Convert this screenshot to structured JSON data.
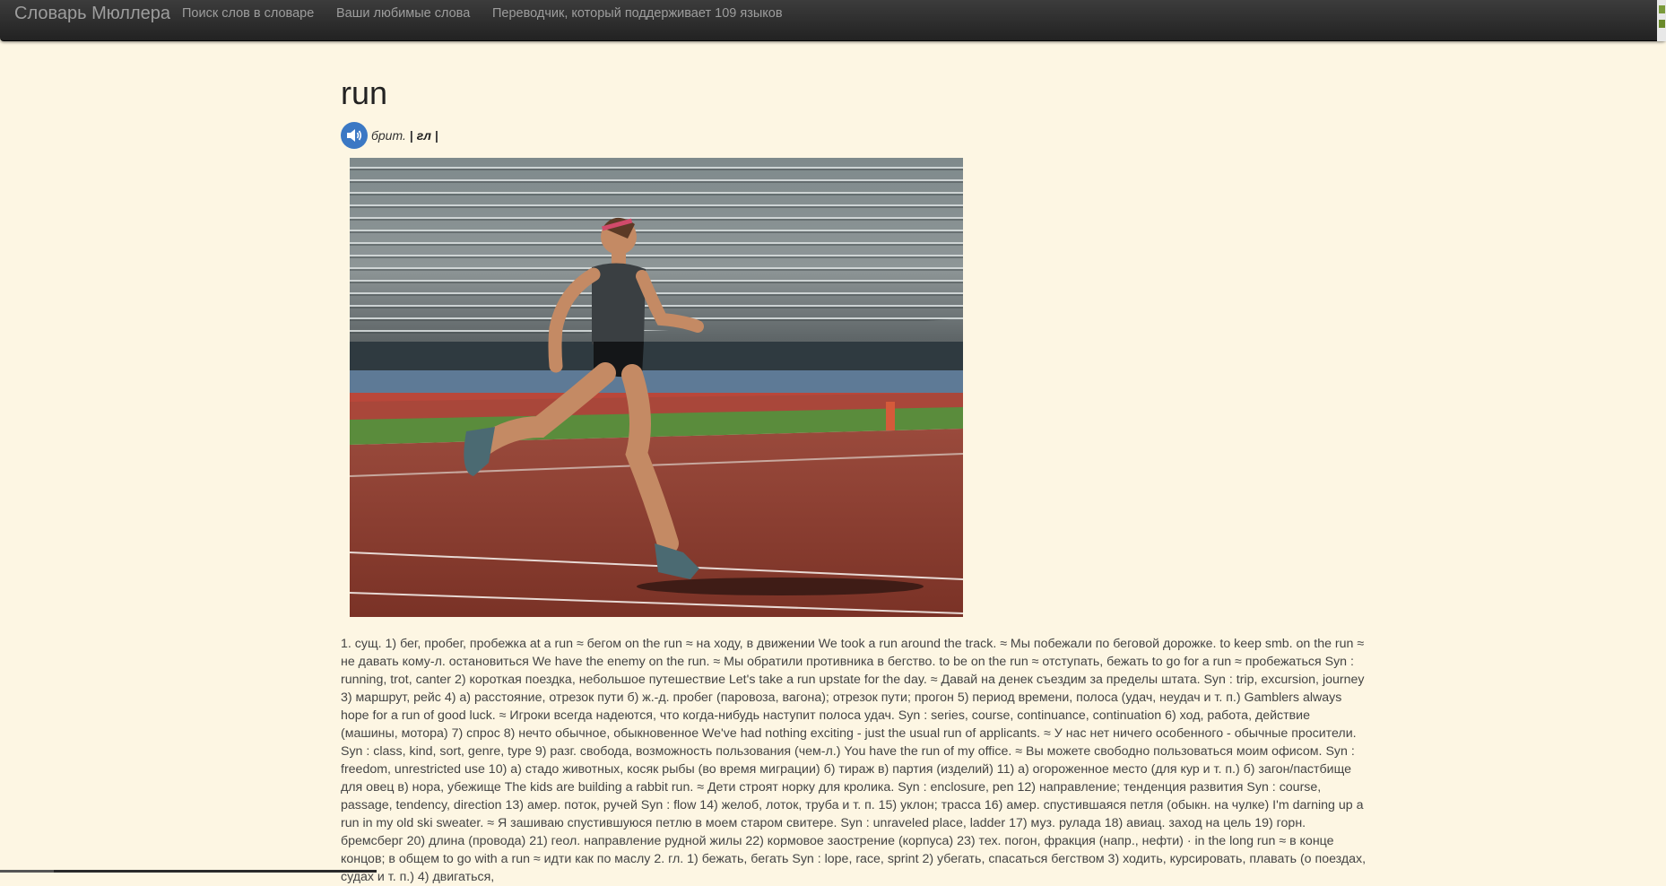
{
  "navbar": {
    "brand": "Словарь Мюллера",
    "links": [
      "Поиск слов в словаре",
      "Ваши любимые слова",
      "Переводчик, который поддерживает 109 языков"
    ]
  },
  "entry": {
    "headword": "run",
    "audio_icon": "speaker-icon",
    "pron_label": "брит.",
    "pron_sep": "|",
    "part_of_speech": "гл",
    "pron_sep_end": "|",
    "image_subject": "runner-on-track-photo",
    "definition": "1. сущ. 1) бег, пробег, пробежка at a run ≈ бегом on the run ≈ на ходу, в движении We took a run around the track. ≈ Мы побежали по беговой дорожке. to keep smb. on the run ≈ не давать кому-л. остановиться We have the enemy on the run. ≈ Мы обратили противника в бегство. to be on the run ≈ отступать, бежать to go for a run ≈ пробежаться Syn : running, trot, canter 2) короткая поездка, небольшое путешествие Let's take a run upstate for the day. ≈ Давай на денек съездим за пределы штата. Syn : trip, excursion, journey 3) маршрут, рейс 4) а) расстояние, отрезок пути б) ж.-д. пробег (паровоза, вагона); отрезок пути; прогон 5) период времени, полоса (удач, неудач и т. п.) Gamblers always hope for a run of good luck. ≈ Игроки всегда надеются, что когда-нибудь наступит полоса удач. Syn : series, course, continuance, continuation 6) ход, работа, действие (машины, мотора) 7) спрос 8) нечто обычное, обыкновенное We've had nothing exciting - just the usual run of applicants. ≈ У нас нет ничего особенного - обычные просители. Syn : class, kind, sort, genre, type 9) разг. свобода, возможность пользования (чем-л.) You have the run of my office. ≈ Вы можете свободно пользоваться моим офисом. Syn : freedom, unrestricted use 10) а) стадо животных, косяк рыбы (во время миграции) б) тираж в) партия (изделий) 11) а) огороженное место (для кур и т. п.) б) загон/пастбище для овец в) нора, убежище The kids are building a rabbit run. ≈ Дети строят норку для кролика. Syn : enclosure, pen 12) направление; тенденция развития Syn : course, passage, tendency, direction 13) амер. поток, ручей Syn : flow 14) желоб, лоток, труба и т. п. 15) уклон; трасса 16) амер. спустившаяся петля (обыкн. на чулке) I'm darning up a run in my old ski sweater. ≈ Я зашиваю спустившуюся петлю в моем старом свитере. Syn : unraveled place, ladder 17) муз. рулада 18) авиац. заход на цель 19) горн. бремсберг 20) длина (провода) 21) геол. направление рудной жилы 22) кормовое заострение (корпуса) 23) тех. погон, фракция (напр., нефти) · in the long run ≈ в конце концов; в общем to go with a run ≈ идти как по маслу 2. гл. 1) бежать, бегать Syn : lope, race, sprint 2) убегать, спасаться бегством 3) ходить, курсировать, плавать (о поездах, судах и т. п.) 4) двигаться,"
  },
  "colors": {
    "page_bg": "#fdf6e3",
    "navbar_bg": "#2b2b2b",
    "nav_text": "#9d9d9d",
    "audio_button": "#3b78c4"
  }
}
